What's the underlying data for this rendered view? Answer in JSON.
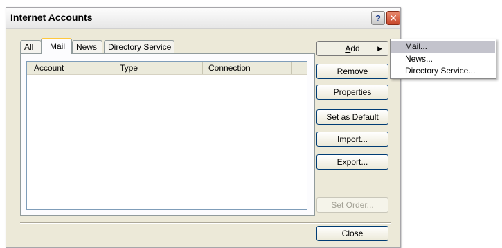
{
  "dialog": {
    "title": "Internet Accounts",
    "help_glyph": "?",
    "close_glyph": "✕"
  },
  "tabs": [
    {
      "label": "All"
    },
    {
      "label": "Mail"
    },
    {
      "label": "News"
    },
    {
      "label": "Directory Service"
    }
  ],
  "active_tab": "Mail",
  "list": {
    "columns": [
      "Account",
      "Type",
      "Connection"
    ],
    "rows": []
  },
  "buttons": {
    "add_prefix": "",
    "add_accel": "A",
    "add_rest": "dd",
    "remove": "Remove",
    "properties": "Properties",
    "set_default": "Set as Default",
    "import": "Import...",
    "export": "Export...",
    "set_order": "Set Order...",
    "close": "Close"
  },
  "add_menu": {
    "items": [
      "Mail...",
      "News...",
      "Directory Service..."
    ],
    "highlighted": "Mail..."
  },
  "colors": {
    "dialog_bg": "#ece9d8",
    "tab_highlight": "#ffc83c",
    "button_border": "#003c74",
    "menu_highlight": "#c3c3cc"
  }
}
